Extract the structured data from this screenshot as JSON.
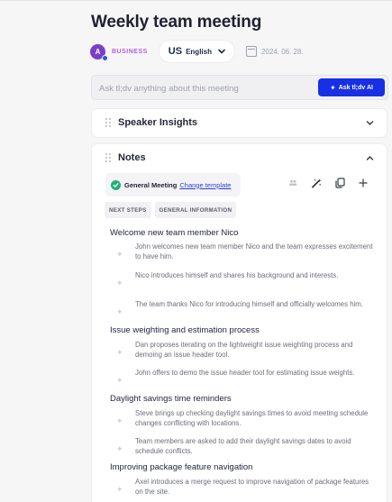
{
  "meeting": {
    "title": "Weekly team meeting",
    "avatar_letter": "A",
    "workspace": "BUSINESS",
    "language_code": "US",
    "language_name": "English",
    "date": "2024. 06. 28."
  },
  "ask": {
    "placeholder": "Ask tl;dv anything about this meeting",
    "button_label": "Ask tl;dv AI"
  },
  "speaker_insights": {
    "title": "Speaker Insights"
  },
  "notes": {
    "title": "Notes",
    "template_label": "General Meeting",
    "change_template": "Change template",
    "tabs": [
      "NEXT STEPS",
      "GENERAL INFORMATION"
    ],
    "sections": [
      {
        "title": "Welcome new team member Nico",
        "items": [
          "John welcomes new team member Nico and the team expresses excitement to have him.",
          "Nico introduces himself and shares his background and interests.",
          "The team thanks Nico for introducing himself and officially welcomes him."
        ]
      },
      {
        "title": "Issue weighting and estimation process",
        "items": [
          "Dan proposes iterating on the lightweight issue weighting process and demoing an issue header tool.",
          "John offers to demo the issue header tool for estimating issue weights."
        ]
      },
      {
        "title": "Daylight savings time reminders",
        "items": [
          "Steve brings up checking daylight savings times to avoid meeting schedule changes conflicting with locations.",
          "Team members are asked to add their daylight savings dates to avoid schedule conflicts."
        ]
      },
      {
        "title": "Improving package feature navigation",
        "items": [
          "Axel introduces a merge request to improve navigation of package features on the site."
        ]
      }
    ]
  },
  "colors": {
    "accent": "#1730e6",
    "workspace": "#b660d6",
    "avatar": "#7a3fc8",
    "check": "#23b07a"
  },
  "icons": [
    "calendar-icon",
    "chevron-down-icon",
    "chevron-up-icon",
    "drag-handle-icon",
    "sparkle-icon",
    "check-circle-icon",
    "people-icon",
    "magic-wand-icon",
    "copy-icon",
    "plus-icon"
  ]
}
